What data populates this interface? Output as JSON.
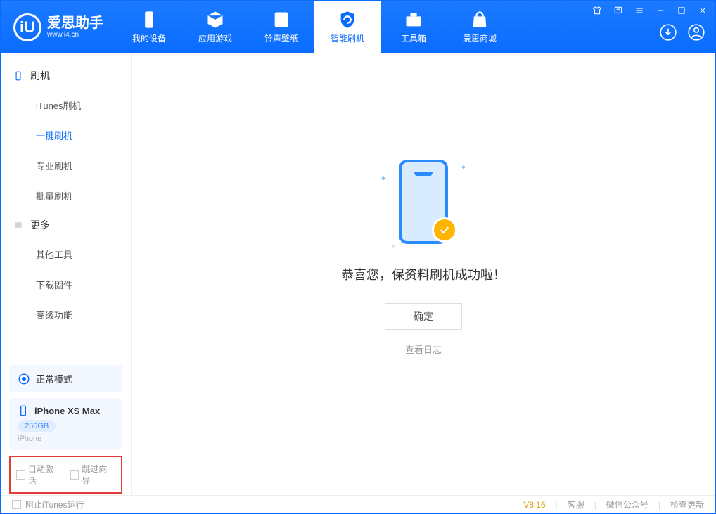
{
  "logo": {
    "main": "爱思助手",
    "sub": "www.i4.cn",
    "letter": "iU"
  },
  "tabs": [
    {
      "label": "我的设备"
    },
    {
      "label": "应用游戏"
    },
    {
      "label": "铃声壁纸"
    },
    {
      "label": "智能刷机"
    },
    {
      "label": "工具箱"
    },
    {
      "label": "爱思商城"
    }
  ],
  "sidebar": {
    "group1_title": "刷机",
    "group1_items": [
      {
        "label": "iTunes刷机"
      },
      {
        "label": "一键刷机"
      },
      {
        "label": "专业刷机"
      },
      {
        "label": "批量刷机"
      }
    ],
    "group2_title": "更多",
    "group2_items": [
      {
        "label": "其他工具"
      },
      {
        "label": "下载固件"
      },
      {
        "label": "高级功能"
      }
    ]
  },
  "mode_label": "正常模式",
  "device": {
    "name": "iPhone XS Max",
    "capacity": "256GB",
    "type": "iPhone"
  },
  "checkboxes": {
    "auto_activate": "自动激活",
    "skip_guide": "跳过向导"
  },
  "main": {
    "success_message": "恭喜您，保资料刷机成功啦！",
    "confirm_button": "确定",
    "view_log": "查看日志"
  },
  "footer": {
    "block_itunes": "阻止iTunes运行",
    "version": "V8.16",
    "customer_service": "客服",
    "wechat": "微信公众号",
    "check_update": "检查更新"
  }
}
